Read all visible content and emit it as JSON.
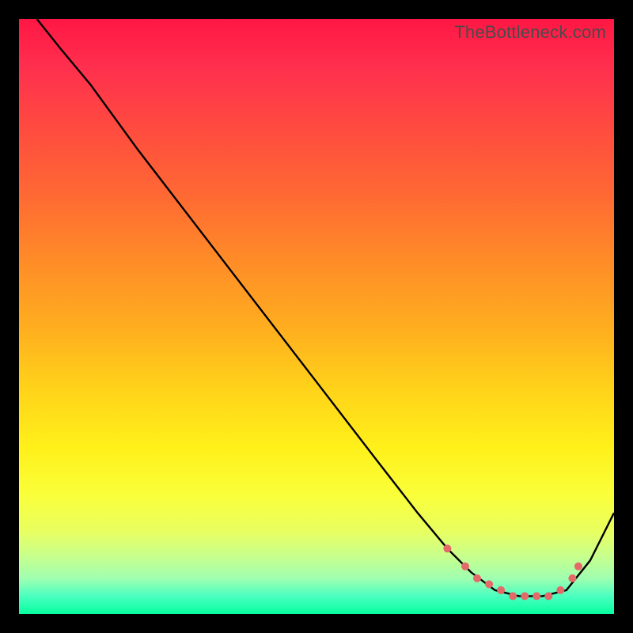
{
  "watermark": "TheBottleneck.com",
  "colors": {
    "curve": "#000000",
    "dot": "#e46a6a"
  },
  "chart_data": {
    "type": "line",
    "title": "",
    "xlabel": "",
    "ylabel": "",
    "xlim": [
      0,
      100
    ],
    "ylim": [
      0,
      100
    ],
    "series": [
      {
        "name": "bottleneck-curve",
        "x": [
          3,
          7,
          12,
          20,
          30,
          40,
          50,
          60,
          67,
          72,
          76,
          80,
          84,
          88,
          92,
          96,
          100
        ],
        "y": [
          100,
          95,
          89,
          78,
          65,
          52,
          39,
          26,
          17,
          11,
          7,
          4,
          3,
          3,
          4,
          9,
          17
        ]
      }
    ],
    "markers": {
      "name": "highlight-dots",
      "x": [
        72,
        75,
        77,
        79,
        81,
        83,
        85,
        87,
        89,
        91,
        93,
        94
      ],
      "y": [
        11,
        8,
        6,
        5,
        4,
        3,
        3,
        3,
        3,
        4,
        6,
        8
      ]
    }
  }
}
